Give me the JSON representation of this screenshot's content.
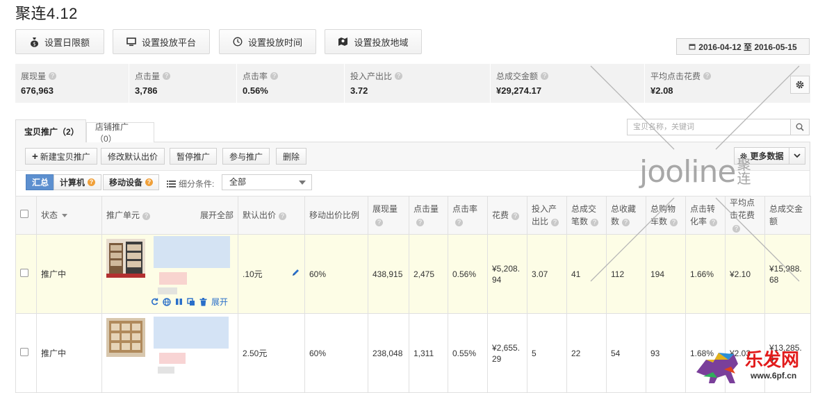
{
  "page": {
    "title": "聚连4.12"
  },
  "settings_buttons": [
    {
      "label": "设置日限额",
      "icon": "money-bag-icon"
    },
    {
      "label": "设置投放平台",
      "icon": "monitor-icon"
    },
    {
      "label": "设置投放时间",
      "icon": "clock-icon"
    },
    {
      "label": "设置投放地域",
      "icon": "map-icon"
    }
  ],
  "date_range": "2016-04-12 至 2016-05-15",
  "stats": [
    {
      "label": "展现量",
      "value": "676,963"
    },
    {
      "label": "点击量",
      "value": "3,786"
    },
    {
      "label": "点击率",
      "value": "0.56%"
    },
    {
      "label": "投入产出比",
      "value": "3.72"
    },
    {
      "label": "总成交金额",
      "value": "¥29,274.17"
    },
    {
      "label": "平均点击花费",
      "value": "¥2.08"
    }
  ],
  "tabs": [
    {
      "label": "宝贝推广（2）",
      "active": true
    },
    {
      "label": "店铺推广（0）",
      "active": false
    }
  ],
  "search": {
    "placeholder": "宝贝名称，关键词"
  },
  "toolbar": {
    "new_label": "新建宝贝推广",
    "edit_bid_label": "修改默认出价",
    "pause_label": "暂停推广",
    "join_label": "参与推广",
    "delete_label": "删除",
    "more_data_label": "更多数据"
  },
  "filter": {
    "segments": [
      {
        "label": "汇总",
        "active": true
      },
      {
        "label": "计算机",
        "active": false
      },
      {
        "label": "移动设备",
        "active": false
      }
    ],
    "condition_label": "细分条件:",
    "condition_value": "全部"
  },
  "table": {
    "headers": {
      "status": "状态",
      "unit": "推广单元",
      "expand_all": "展开全部",
      "bid": "默认出价",
      "mobile_ratio": "移动出价比例",
      "impressions": "展现量",
      "clicks": "点击量",
      "ctr": "点击率",
      "cost": "花费",
      "roi": "投入产出比",
      "orders": "总成交笔数",
      "favorites": "总收藏数",
      "carts": "总购物车数",
      "cvr": "点击转化率",
      "cpc": "平均点击花费",
      "gmv": "总成交金额"
    },
    "rows": [
      {
        "status": "推广中",
        "bid": ".10元",
        "mobile_ratio": "60%",
        "impressions": "438,915",
        "clicks": "2,475",
        "ctr": "0.56%",
        "cost": "¥5,208.94",
        "roi": "3.07",
        "orders": "41",
        "favorites": "112",
        "carts": "194",
        "cvr": "1.66%",
        "cpc": "¥2.10",
        "gmv": "¥15,988.68",
        "expand_label": "展开"
      },
      {
        "status": "推广中",
        "bid": "2.50元",
        "mobile_ratio": "60%",
        "impressions": "238,048",
        "clicks": "1,311",
        "ctr": "0.55%",
        "cost": "¥2,655.29",
        "roi": "5",
        "orders": "22",
        "favorites": "54",
        "carts": "93",
        "cvr": "1.68%",
        "cpc": "¥2.03",
        "gmv": "¥13,285.4"
      }
    ]
  },
  "watermark": {
    "brand": "jooline",
    "brand_cn": "聚连"
  },
  "site_logo": {
    "text": "乐发网",
    "url": "www.6pf.cn"
  }
}
